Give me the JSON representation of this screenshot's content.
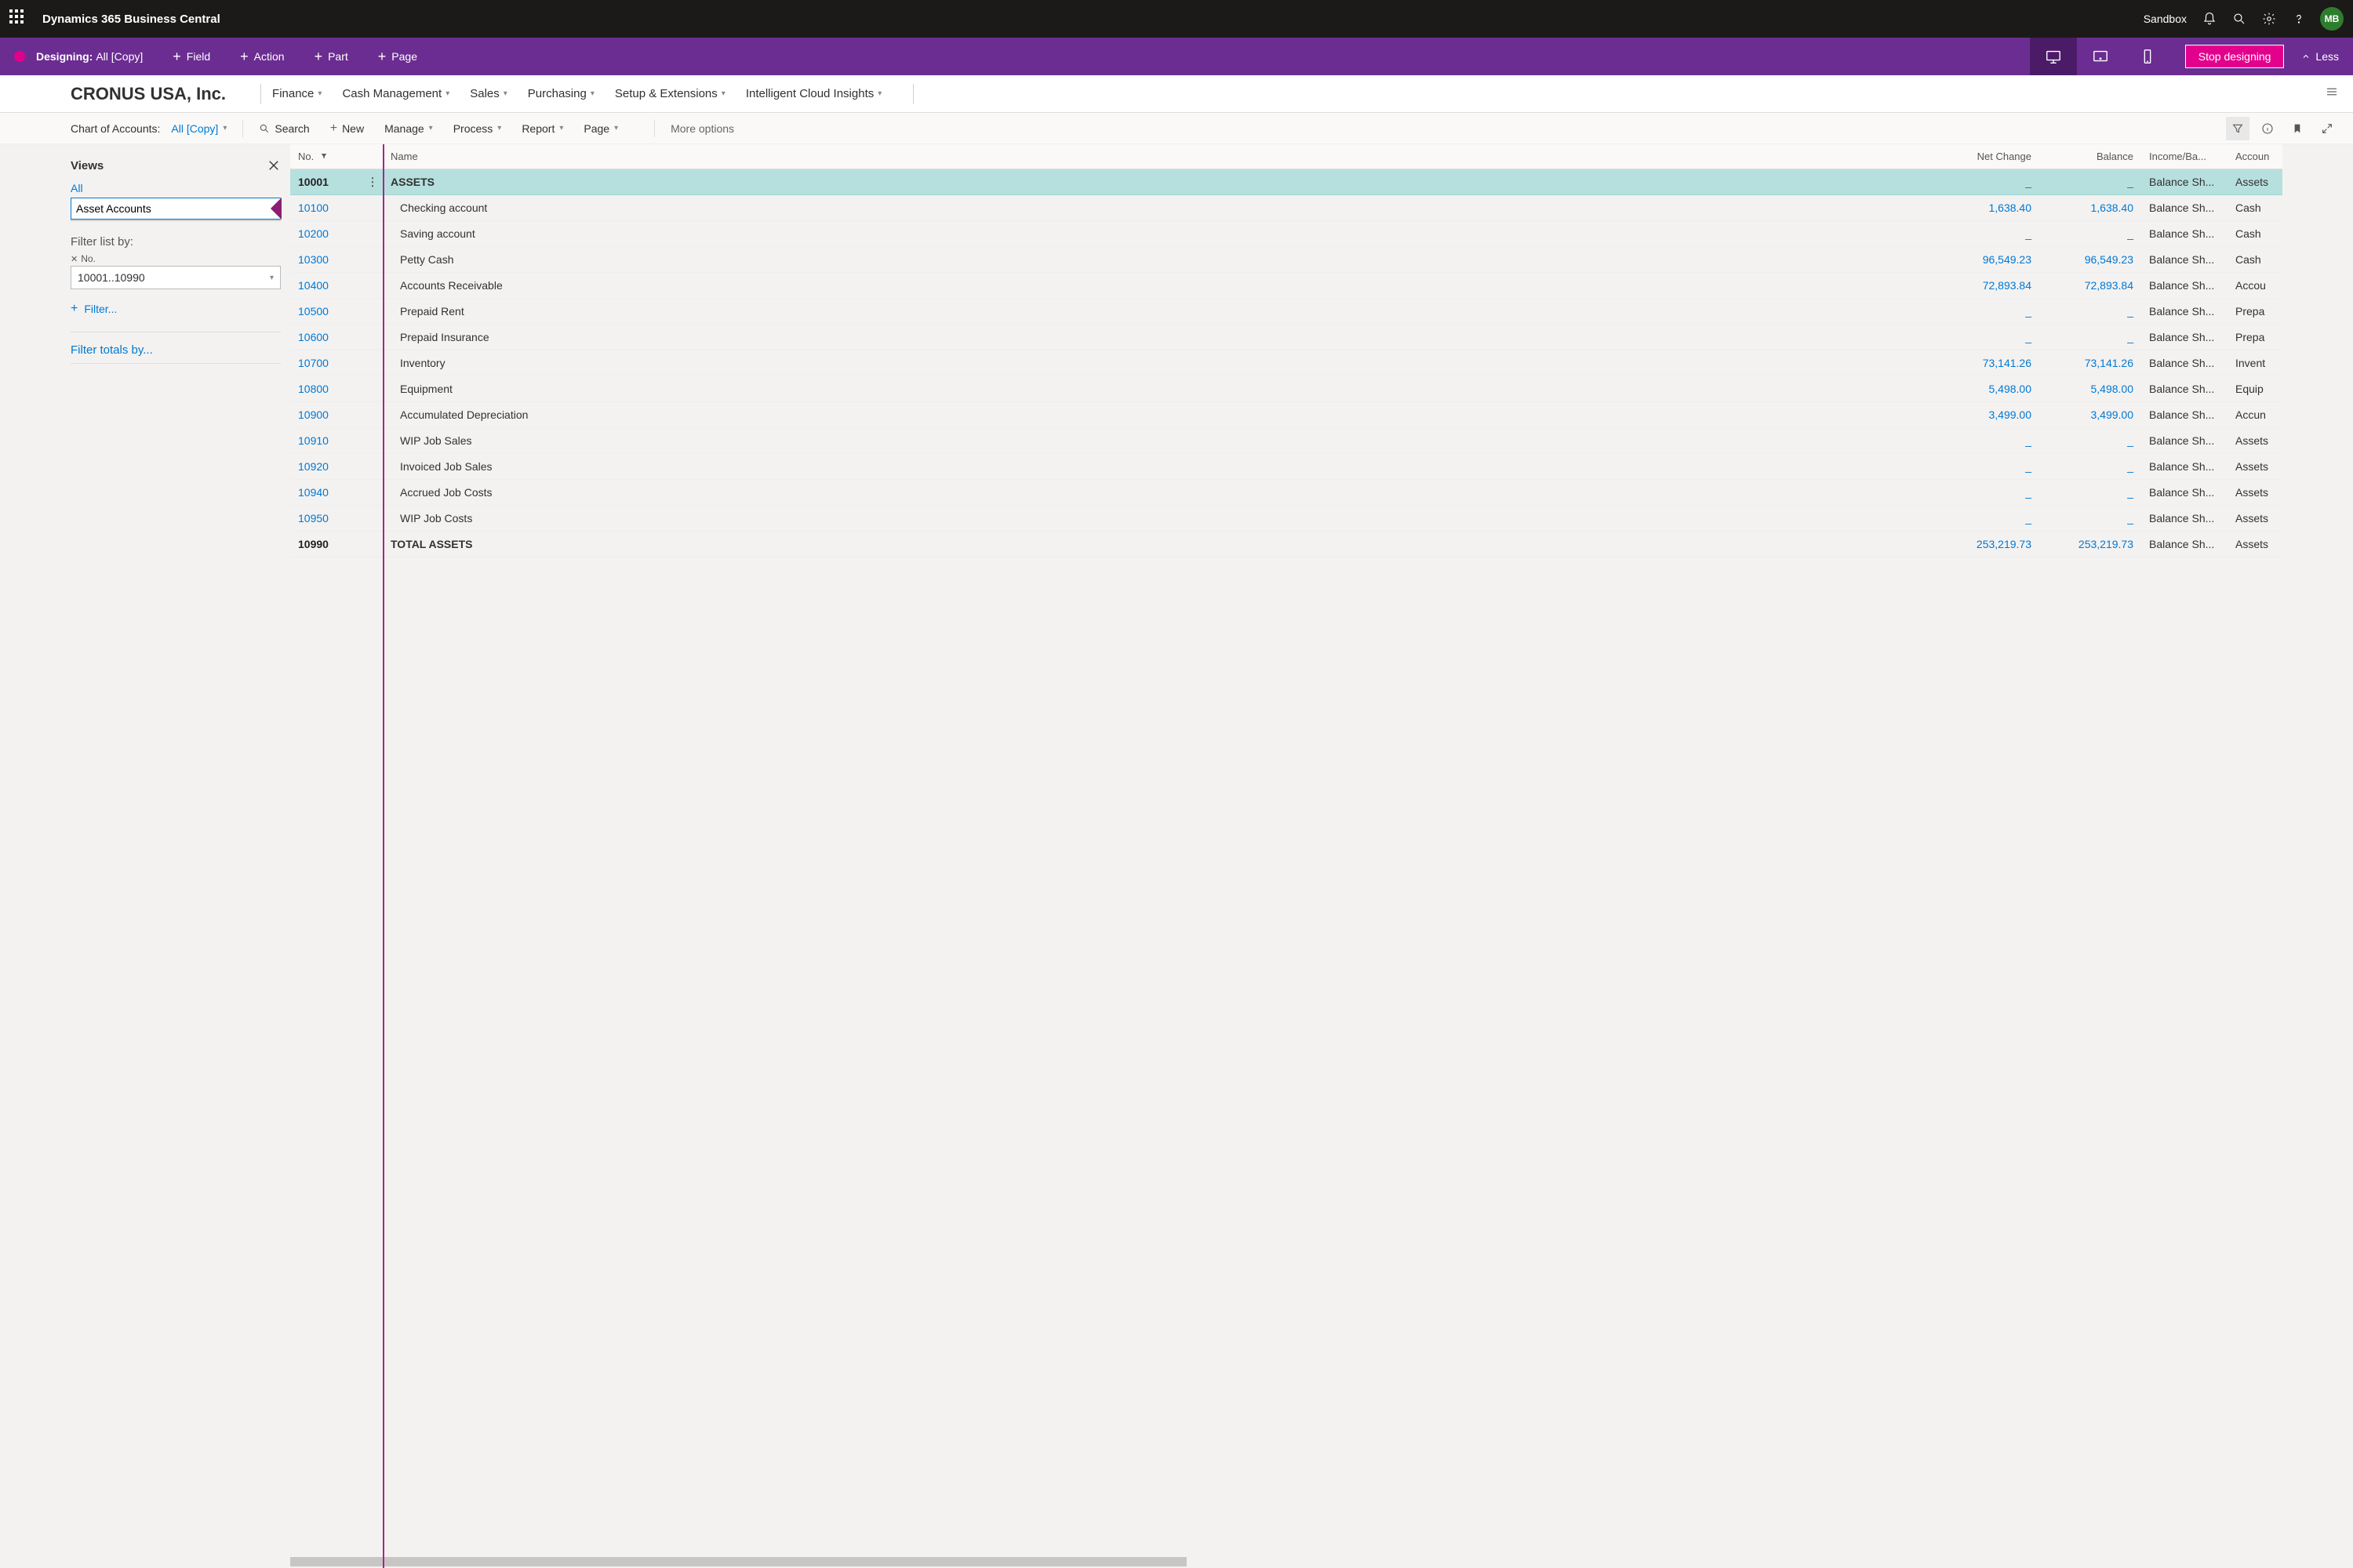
{
  "topbar": {
    "title": "Dynamics 365 Business Central",
    "env": "Sandbox",
    "avatar": "MB"
  },
  "designbar": {
    "label": "Designing:",
    "sub": "All [Copy]",
    "add_field": "Field",
    "add_action": "Action",
    "add_part": "Part",
    "add_page": "Page",
    "stop": "Stop designing",
    "less": "Less"
  },
  "header": {
    "company": "CRONUS USA, Inc.",
    "nav": [
      "Finance",
      "Cash Management",
      "Sales",
      "Purchasing",
      "Setup & Extensions",
      "Intelligent Cloud Insights"
    ]
  },
  "toolbar": {
    "page_label": "Chart of Accounts:",
    "view": "All [Copy]",
    "search": "Search",
    "new": "New",
    "manage": "Manage",
    "process": "Process",
    "report": "Report",
    "page": "Page",
    "more": "More options"
  },
  "views": {
    "title": "Views",
    "all": "All",
    "input": "Asset Accounts",
    "filter_list": "Filter list by:",
    "field": "No.",
    "value": "10001..10990",
    "add_filter": "Filter...",
    "filter_totals": "Filter totals by..."
  },
  "grid": {
    "cols": {
      "no": "No.",
      "name": "Name",
      "net": "Net Change",
      "bal": "Balance",
      "ib": "Income/Ba...",
      "ac": "Accoun"
    },
    "rows": [
      {
        "no": "10001",
        "name": "ASSETS",
        "net": "_",
        "bal": "_",
        "ib": "Balance Sh...",
        "ac": "Assets",
        "bold": true,
        "sel": true
      },
      {
        "no": "10100",
        "name": "Checking account",
        "net": "1,638.40",
        "bal": "1,638.40",
        "ib": "Balance Sh...",
        "ac": "Cash"
      },
      {
        "no": "10200",
        "name": "Saving account",
        "net": "_",
        "bal": "_",
        "ib": "Balance Sh...",
        "ac": "Cash"
      },
      {
        "no": "10300",
        "name": "Petty Cash",
        "net": "96,549.23",
        "bal": "96,549.23",
        "ib": "Balance Sh...",
        "ac": "Cash"
      },
      {
        "no": "10400",
        "name": "Accounts Receivable",
        "net": "72,893.84",
        "bal": "72,893.84",
        "ib": "Balance Sh...",
        "ac": "Accou"
      },
      {
        "no": "10500",
        "name": "Prepaid Rent",
        "net": "_",
        "bal": "_",
        "ib": "Balance Sh...",
        "ac": "Prepa"
      },
      {
        "no": "10600",
        "name": "Prepaid Insurance",
        "net": "_",
        "bal": "_",
        "ib": "Balance Sh...",
        "ac": "Prepa"
      },
      {
        "no": "10700",
        "name": "Inventory",
        "net": "73,141.26",
        "bal": "73,141.26",
        "ib": "Balance Sh...",
        "ac": "Invent"
      },
      {
        "no": "10800",
        "name": "Equipment",
        "net": "5,498.00",
        "bal": "5,498.00",
        "ib": "Balance Sh...",
        "ac": "Equip"
      },
      {
        "no": "10900",
        "name": "Accumulated Depreciation",
        "net": "3,499.00",
        "bal": "3,499.00",
        "ib": "Balance Sh...",
        "ac": "Accun"
      },
      {
        "no": "10910",
        "name": "WIP Job Sales",
        "net": "_",
        "bal": "_",
        "ib": "Balance Sh...",
        "ac": "Assets"
      },
      {
        "no": "10920",
        "name": "Invoiced Job Sales",
        "net": "_",
        "bal": "_",
        "ib": "Balance Sh...",
        "ac": "Assets"
      },
      {
        "no": "10940",
        "name": "Accrued Job Costs",
        "net": "_",
        "bal": "_",
        "ib": "Balance Sh...",
        "ac": "Assets"
      },
      {
        "no": "10950",
        "name": "WIP Job Costs",
        "net": "_",
        "bal": "_",
        "ib": "Balance Sh...",
        "ac": "Assets"
      },
      {
        "no": "10990",
        "name": "TOTAL ASSETS",
        "net": "253,219.73",
        "bal": "253,219.73",
        "ib": "Balance Sh...",
        "ac": "Assets",
        "bold": true
      }
    ]
  }
}
